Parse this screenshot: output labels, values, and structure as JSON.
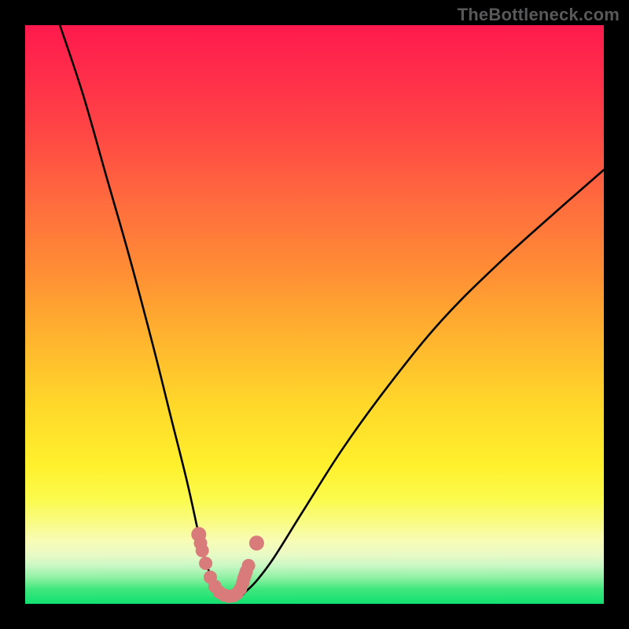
{
  "watermark": "TheBottleneck.com",
  "colors": {
    "dot": "#d97b7b",
    "curve": "#000000",
    "frame": "#000000"
  },
  "chart_data": {
    "type": "line",
    "title": "",
    "xlabel": "",
    "ylabel": "",
    "xlim": [
      0,
      100
    ],
    "ylim": [
      0,
      100
    ],
    "grid": false,
    "legend": false,
    "annotations": [
      "TheBottleneck.com"
    ],
    "series": [
      {
        "name": "bottleneck-curve",
        "x": [
          6,
          10,
          14,
          18,
          22,
          25,
          28,
          30,
          31,
          32,
          33,
          34,
          35,
          36,
          37,
          38,
          40,
          43,
          48,
          55,
          63,
          72,
          82,
          92,
          100
        ],
        "values": [
          100,
          88,
          74,
          60,
          45,
          33,
          21,
          12,
          8,
          5,
          3,
          2,
          1,
          1,
          1,
          2,
          4,
          8,
          16,
          27,
          38,
          49,
          59,
          68,
          75
        ]
      }
    ],
    "marker_points": {
      "name": "highlight-dots",
      "x": [
        30,
        30.3,
        30.6,
        31.2,
        32.0,
        32.8,
        33.6,
        34.4,
        35.2,
        36.0,
        36.6,
        37.2,
        37.6,
        37.8,
        38.0,
        38.2,
        38.6,
        40.0
      ],
      "values": [
        12,
        10.5,
        9.2,
        7.0,
        4.6,
        3.0,
        2.0,
        1.5,
        1.3,
        1.4,
        1.8,
        2.6,
        3.6,
        4.4,
        5.0,
        5.6,
        6.6,
        10.5
      ]
    }
  }
}
